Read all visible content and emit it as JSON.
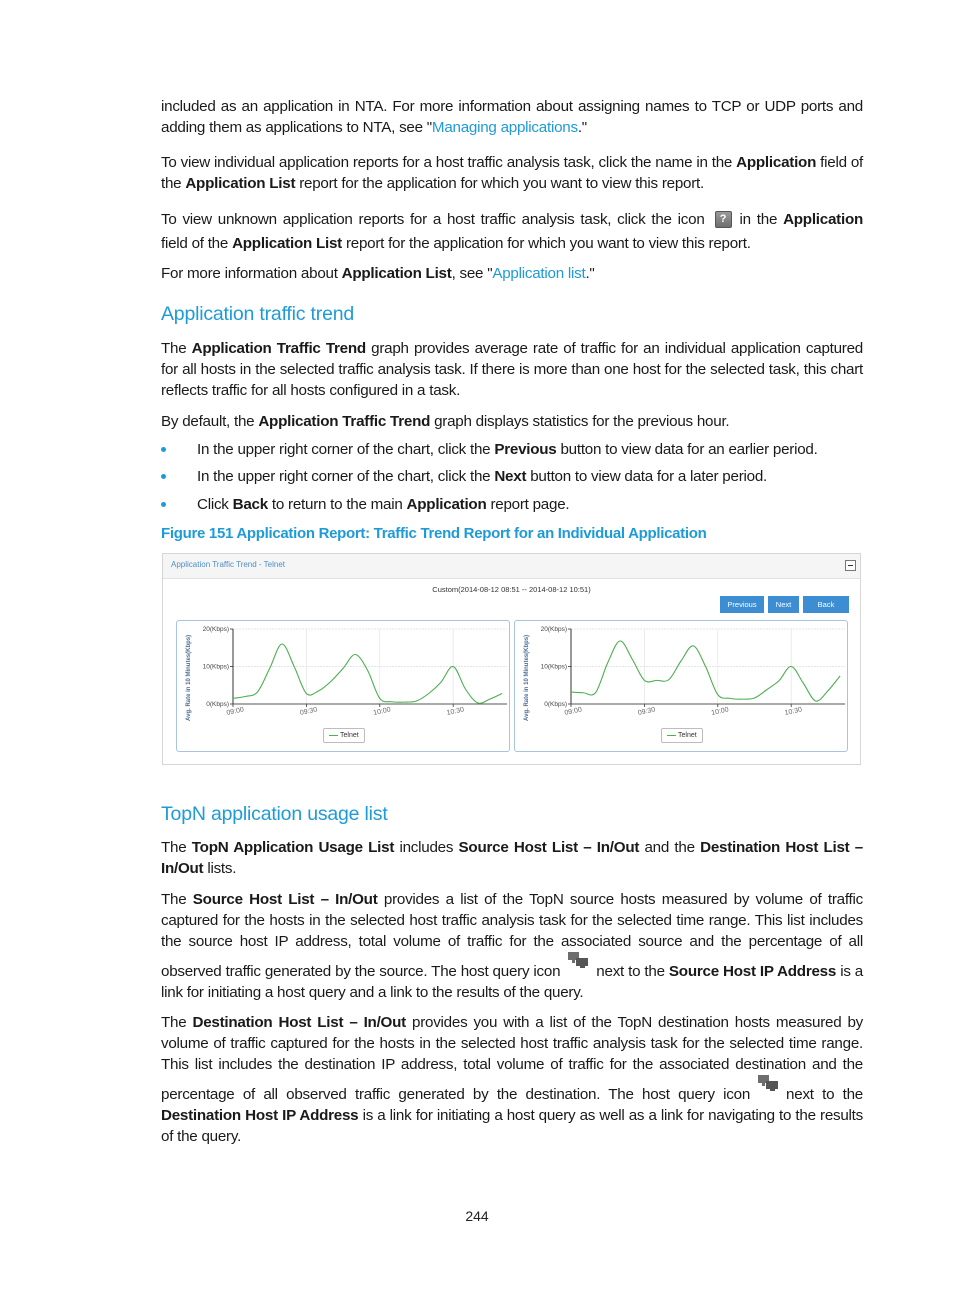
{
  "intro": {
    "p1_a": "included as an application in NTA. For more information about assigning names to TCP or UDP ports and adding them as applications to NTA, see \"",
    "p1_link": "Managing applications",
    "p1_b": ".\"",
    "p2_a": "To view individual application reports for a host traffic analysis task, click the name in the ",
    "p2_b1": "Application",
    "p2_c": " field of the ",
    "p2_b2": "Application List",
    "p2_d": " report for the application for which you want to view this report.",
    "p3_a": "To view unknown application reports for a host traffic analysis task, click the icon",
    "p3_icon": "help-icon",
    "p3_b": "in the ",
    "p3_b1": "Application",
    "p3_c": " field of the ",
    "p3_b2": "Application List",
    "p3_d": " report for the application for which you want to view this report.",
    "p4_a": "For more information about ",
    "p4_b1": "Application List",
    "p4_c": ", see \"",
    "p4_link": "Application list",
    "p4_d": ".\""
  },
  "section1": {
    "heading": "Application traffic trend",
    "p1_a": "The ",
    "p1_b1": "Application Traffic Trend",
    "p1_c": " graph provides average rate of traffic for an individual application captured for all hosts in the selected traffic analysis task. If there is more than one host for the selected task, this chart reflects traffic for all hosts configured in a task.",
    "p2_a": "By default, the ",
    "p2_b1": "Application Traffic Trend",
    "p2_c": " graph displays statistics for the previous hour.",
    "bullets": [
      {
        "a": "In the upper right corner of the chart, click the ",
        "b": "Previous",
        "c": " button to view data for an earlier period.",
        "d": "",
        "e": ""
      },
      {
        "a": "In the upper right corner of the chart, click the ",
        "b": "Next",
        "c": " button to view data for a later period.",
        "d": "",
        "e": ""
      },
      {
        "a": "Click ",
        "b": "Back",
        "c": " to return to the main ",
        "d": "Application",
        "e": " report page."
      }
    ],
    "caption": "Figure 151 Application Report: Traffic Trend Report for an Individual Application"
  },
  "figure": {
    "panel_title": "Application Traffic Trend - Telnet",
    "time_range": "Custom(2014-08-12 08:51 -- 2014-08-12 10:51)",
    "buttons": {
      "previous": "Previous",
      "next": "Next",
      "back": "Back"
    },
    "accent_color": "#3d8dd3",
    "line_color": "#4caf50"
  },
  "chart_data": [
    {
      "type": "line",
      "title": "",
      "xlabel": "",
      "ylabel": "Avg. Rate in 10 Minutes(Kbps)",
      "ylim": [
        0,
        20
      ],
      "yticks": [
        "0(Kbps)",
        "10(Kbps)",
        "20(Kbps)"
      ],
      "ytick_values": [
        0,
        10,
        20
      ],
      "xticks": [
        "09:00",
        "09:30",
        "10:00",
        "10:30"
      ],
      "xtick_minutes": [
        0,
        30,
        60,
        90
      ],
      "xlim_minutes": [
        0,
        112
      ],
      "grid": true,
      "legend": "bottom-center",
      "series": [
        {
          "name": "Telnet",
          "x_minutes": [
            0,
            5,
            10,
            15,
            20,
            25,
            30,
            35,
            40,
            45,
            50,
            55,
            60,
            65,
            70,
            75,
            80,
            85,
            90,
            95,
            100,
            105,
            110
          ],
          "values": [
            1.5,
            2.0,
            3.2,
            9.5,
            16.0,
            10.0,
            2.8,
            3.5,
            6.0,
            9.5,
            13.2,
            9.0,
            1.5,
            0.6,
            0.5,
            0.8,
            2.8,
            5.8,
            10.0,
            4.0,
            0.3,
            1.3,
            2.8
          ]
        }
      ]
    },
    {
      "type": "line",
      "title": "",
      "xlabel": "",
      "ylabel": "Avg. Rate in 10 Minutes(Kbps)",
      "ylim": [
        0,
        20
      ],
      "yticks": [
        "0(Kbps)",
        "10(Kbps)",
        "20(Kbps)"
      ],
      "ytick_values": [
        0,
        10,
        20
      ],
      "xticks": [
        "09:00",
        "09:30",
        "10:00",
        "10:30"
      ],
      "xtick_minutes": [
        0,
        30,
        60,
        90
      ],
      "xlim_minutes": [
        0,
        112
      ],
      "grid": true,
      "legend": "bottom-center",
      "series": [
        {
          "name": "Telnet",
          "x_minutes": [
            0,
            5,
            10,
            15,
            20,
            25,
            30,
            35,
            40,
            45,
            50,
            55,
            60,
            65,
            70,
            75,
            80,
            85,
            90,
            95,
            100,
            105,
            110
          ],
          "values": [
            3.2,
            3.0,
            3.0,
            11.0,
            16.8,
            12.0,
            6.3,
            6.3,
            6.5,
            11.5,
            15.5,
            10.0,
            2.5,
            1.5,
            1.3,
            1.6,
            3.8,
            6.2,
            10.0,
            5.5,
            0.8,
            3.5,
            7.5
          ]
        }
      ]
    }
  ],
  "section2": {
    "heading": "TopN application usage list",
    "p1": {
      "a": "The ",
      "b1": "TopN Application Usage List",
      "c": " includes ",
      "b2": "Source Host List – In/Out",
      "d": " and the ",
      "b3": "Destination Host List – In/Out",
      "e": " lists."
    },
    "p2": {
      "a": "The ",
      "b1": "Source Host List – In/Out",
      "c": " provides a list of the TopN source hosts measured by volume of traffic captured for the hosts in the selected host traffic analysis task for the selected time range. This list includes the source host IP address, total volume of traffic for the associated source and the percentage of all observed traffic generated by the source. The host query icon",
      "icon": "host-query-icon",
      "d": "next to the ",
      "b2": "Source Host IP Address",
      "e": " is a link for initiating a host query and a link to the results of the query."
    },
    "p3": {
      "a": "The ",
      "b1": "Destination Host List – In/Out",
      "c": " provides you with a list of the TopN destination hosts measured by volume of traffic captured for the hosts in the selected host traffic analysis task for the selected time range. This list includes the destination IP address, total volume of traffic for the associated destination and the percentage of all observed traffic generated by the destination. The host query icon",
      "icon": "host-query-icon",
      "d": "next to the ",
      "b2": "Destination Host IP Address",
      "e": " is a link for initiating a host query as well as a link for navigating to the results of the query."
    }
  },
  "footer": {
    "page_number": "244"
  }
}
